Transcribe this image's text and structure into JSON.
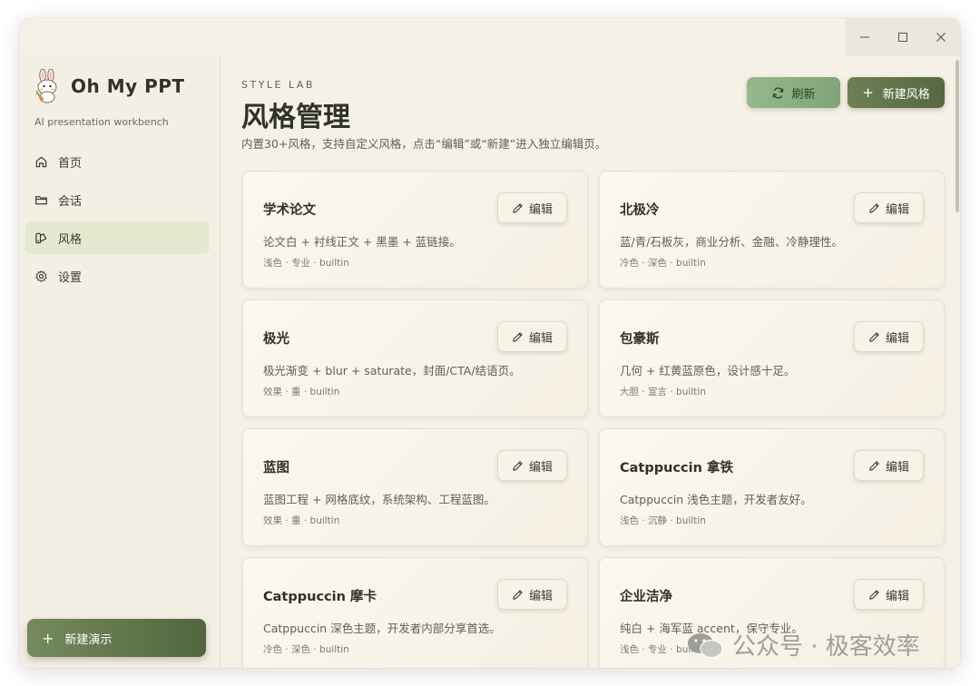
{
  "app": {
    "title": "Oh My PPT",
    "subtitle": "AI presentation workbench",
    "window_controls": [
      "minimize",
      "maximize",
      "close"
    ]
  },
  "sidebar": {
    "items": [
      {
        "label": "首页",
        "icon": "home-icon",
        "active": false
      },
      {
        "label": "会话",
        "icon": "folder-icon",
        "active": false
      },
      {
        "label": "风格",
        "icon": "palette-icon",
        "active": true
      },
      {
        "label": "设置",
        "icon": "gear-icon",
        "active": false
      }
    ],
    "new_deck_label": "新建演示"
  },
  "header": {
    "eyebrow": "STYLE LAB",
    "title": "风格管理",
    "description": "内置30+风格，支持自定义风格，点击“编辑”或“新建”进入独立编辑页。",
    "refresh_label": "刷新",
    "new_style_label": "新建风格"
  },
  "styles": [
    {
      "name": "学术论文",
      "desc": "论文白 + 衬线正文 + 黑墨 + 蓝链接。",
      "tags": "浅色 · 专业 · builtin",
      "edit_label": "编辑"
    },
    {
      "name": "北极冷",
      "desc": "蓝/青/石板灰，商业分析、金融、冷静理性。",
      "tags": "冷色 · 深色 · builtin",
      "edit_label": "编辑"
    },
    {
      "name": "极光",
      "desc": "极光渐变 + blur + saturate，封面/CTA/结语页。",
      "tags": "效果 · 重 · builtin",
      "edit_label": "编辑"
    },
    {
      "name": "包豪斯",
      "desc": "几何 + 红黄蓝原色，设计感十足。",
      "tags": "大胆 · 宣言 · builtin",
      "edit_label": "编辑"
    },
    {
      "name": "蓝图",
      "desc": "蓝图工程 + 网格底纹，系统架构、工程蓝图。",
      "tags": "效果 · 重 · builtin",
      "edit_label": "编辑"
    },
    {
      "name": "Catppuccin 拿铁",
      "desc": "Catppuccin 浅色主题，开发者友好。",
      "tags": "浅色 · 沉静 · builtin",
      "edit_label": "编辑"
    },
    {
      "name": "Catppuccin 摩卡",
      "desc": "Catppuccin 深色主题，开发者内部分享首选。",
      "tags": "冷色 · 深色 · builtin",
      "edit_label": "编辑"
    },
    {
      "name": "企业洁净",
      "desc": "纯白 + 海军蓝 accent，保守专业。",
      "tags": "浅色 · 专业 · builtin",
      "edit_label": "编辑"
    }
  ],
  "watermark": {
    "text": "公众号 · 极客效率"
  },
  "colors": {
    "accent": "#55683f",
    "active_nav": "#e3ead0",
    "background": "#f6f1e7"
  }
}
